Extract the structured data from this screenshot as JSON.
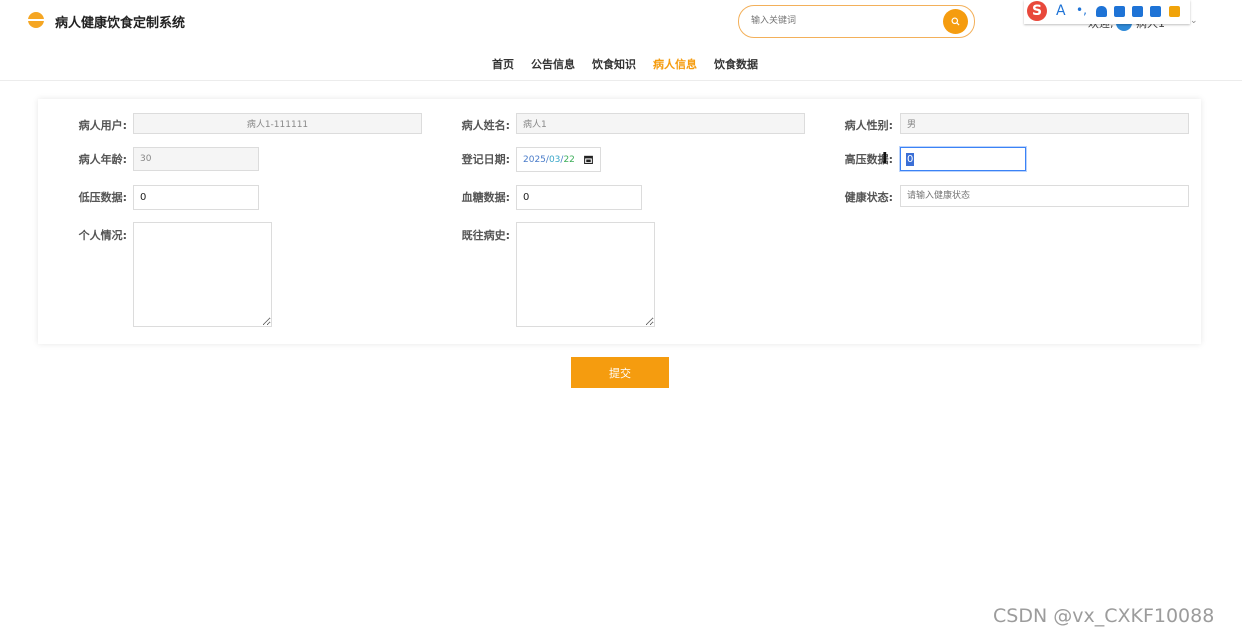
{
  "header": {
    "site_title": "病人健康饮食定制系统",
    "search_placeholder": "输入关键词",
    "greeting": "欢迎,",
    "user_name": "病人1"
  },
  "nav": {
    "items": [
      "首页",
      "公告信息",
      "饮食知识",
      "病人信息",
      "饮食数据"
    ],
    "active": "病人信息"
  },
  "form": {
    "patient_user": {
      "label": "病人用户:",
      "value": "病人1-111111"
    },
    "patient_name": {
      "label": "病人姓名:",
      "value": "病人1"
    },
    "patient_gender": {
      "label": "病人性别:",
      "value": "男"
    },
    "patient_age": {
      "label": "病人年龄:",
      "value": "30"
    },
    "register_date": {
      "label": "登记日期:",
      "year": "2025",
      "month": "03",
      "day": "22",
      "sep": "/"
    },
    "high_pressure": {
      "label": "高压数据:",
      "value": "0"
    },
    "low_pressure": {
      "label": "低压数据:",
      "value": "0"
    },
    "blood_sugar": {
      "label": "血糖数据:",
      "value": "0"
    },
    "health_status": {
      "label": "健康状态:",
      "placeholder": "请输入健康状态"
    },
    "personal_situation": {
      "label": "个人情况:",
      "value": ""
    },
    "past_history": {
      "label": "既往病史:",
      "value": ""
    },
    "submit_label": "提交"
  },
  "ime_toolbar": {
    "brand": "S",
    "letter": "A",
    "dots": "•,"
  },
  "watermark": "CSDN @vx_CXKF10088",
  "colors": {
    "accent": "#f59c0f",
    "focus": "#3b82f6"
  }
}
